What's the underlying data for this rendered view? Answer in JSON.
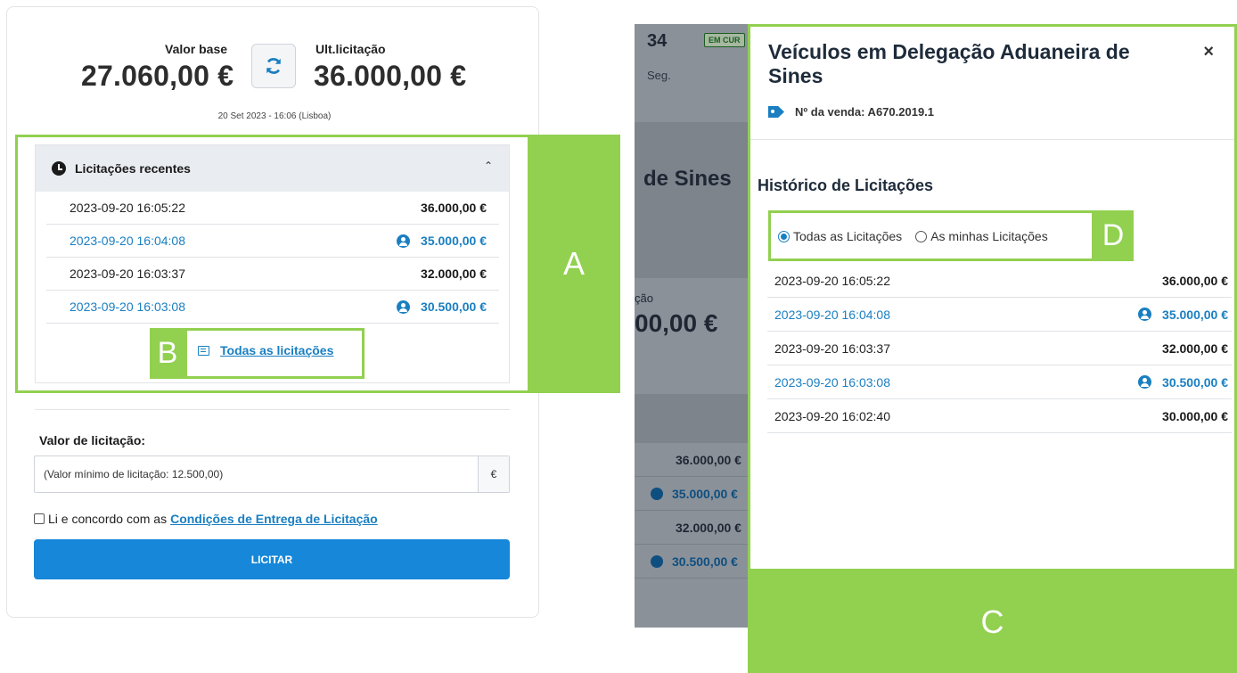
{
  "left": {
    "base_label": "Valor base",
    "base_value": "27.060,00 €",
    "last_label": "Ult.licitação",
    "last_value": "36.000,00 €",
    "timestamp": "20 Set 2023 - 16:06 (Lisboa)",
    "recent": {
      "title": "Licitações recentes",
      "rows": [
        {
          "date": "2023-09-20 16:05:22",
          "amount": "36.000,00 €",
          "mine": false
        },
        {
          "date": "2023-09-20 16:04:08",
          "amount": "35.000,00 €",
          "mine": true
        },
        {
          "date": "2023-09-20 16:03:37",
          "amount": "32.000,00 €",
          "mine": false
        },
        {
          "date": "2023-09-20 16:03:08",
          "amount": "30.500,00 €",
          "mine": true
        }
      ],
      "all_link": "Todas as licitações"
    },
    "bid_label": "Valor de licitação:",
    "bid_placeholder": "(Valor mínimo de licitação: 12.500,00)",
    "currency": "€",
    "terms_text": "Li e concordo com as",
    "terms_link": "Condições de Entrega de Licitação",
    "bid_button": "LICITAR"
  },
  "background": {
    "number": "34",
    "badge": "EM CUR",
    "seg": "Seg.",
    "sines": "de Sines",
    "cao": "ção",
    "big_value": "00,00 €",
    "rows": [
      {
        "amount": "36.000,00 €",
        "mine": false
      },
      {
        "amount": "35.000,00 €",
        "mine": true
      },
      {
        "amount": "32.000,00 €",
        "mine": false
      },
      {
        "amount": "30.500,00 €",
        "mine": true
      }
    ]
  },
  "modal": {
    "title": "Veículos em Delegação Aduaneira de Sines",
    "close": "×",
    "sale_no": "Nº da venda: A670.2019.1",
    "history_title": "Histórico de Licitações",
    "filter_all": "Todas as Licitações",
    "filter_mine": "As minhas Licitações",
    "rows": [
      {
        "date": "2023-09-20 16:05:22",
        "amount": "36.000,00 €",
        "mine": false
      },
      {
        "date": "2023-09-20 16:04:08",
        "amount": "35.000,00 €",
        "mine": true
      },
      {
        "date": "2023-09-20 16:03:37",
        "amount": "32.000,00 €",
        "mine": false
      },
      {
        "date": "2023-09-20 16:03:08",
        "amount": "30.500,00 €",
        "mine": true
      },
      {
        "date": "2023-09-20 16:02:40",
        "amount": "30.000,00 €",
        "mine": false
      }
    ]
  },
  "callouts": {
    "a": "A",
    "b": "B",
    "c": "C",
    "d": "D"
  },
  "colors": {
    "accent": "#1a7fc1",
    "callout": "#92d050",
    "button": "#1687d9"
  }
}
